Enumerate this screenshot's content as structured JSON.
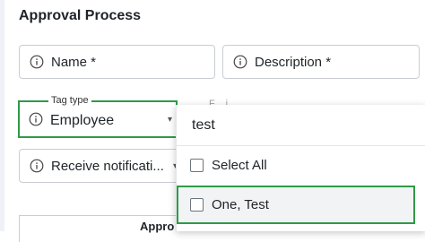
{
  "section": {
    "title": "Approval Process"
  },
  "fields": {
    "name_label": "Name *",
    "description_label": "Description *",
    "tag_type_label": "Tag type",
    "tag_type_value": "Employee",
    "receive_label": "Receive notificati..."
  },
  "dropdown": {
    "search_value": "test",
    "options": [
      {
        "label": "Select All",
        "checked": false
      },
      {
        "label": "One, Test",
        "checked": false
      }
    ]
  },
  "table": {
    "header": "Appro"
  },
  "icons": {
    "info": "info-circle-icon",
    "chevron": "chevron-down-icon",
    "checkbox": "checkbox-icon"
  },
  "colors": {
    "highlight": "#2e9b47",
    "border": "#c9cdd2",
    "option_hover": "#f1f3f5"
  }
}
